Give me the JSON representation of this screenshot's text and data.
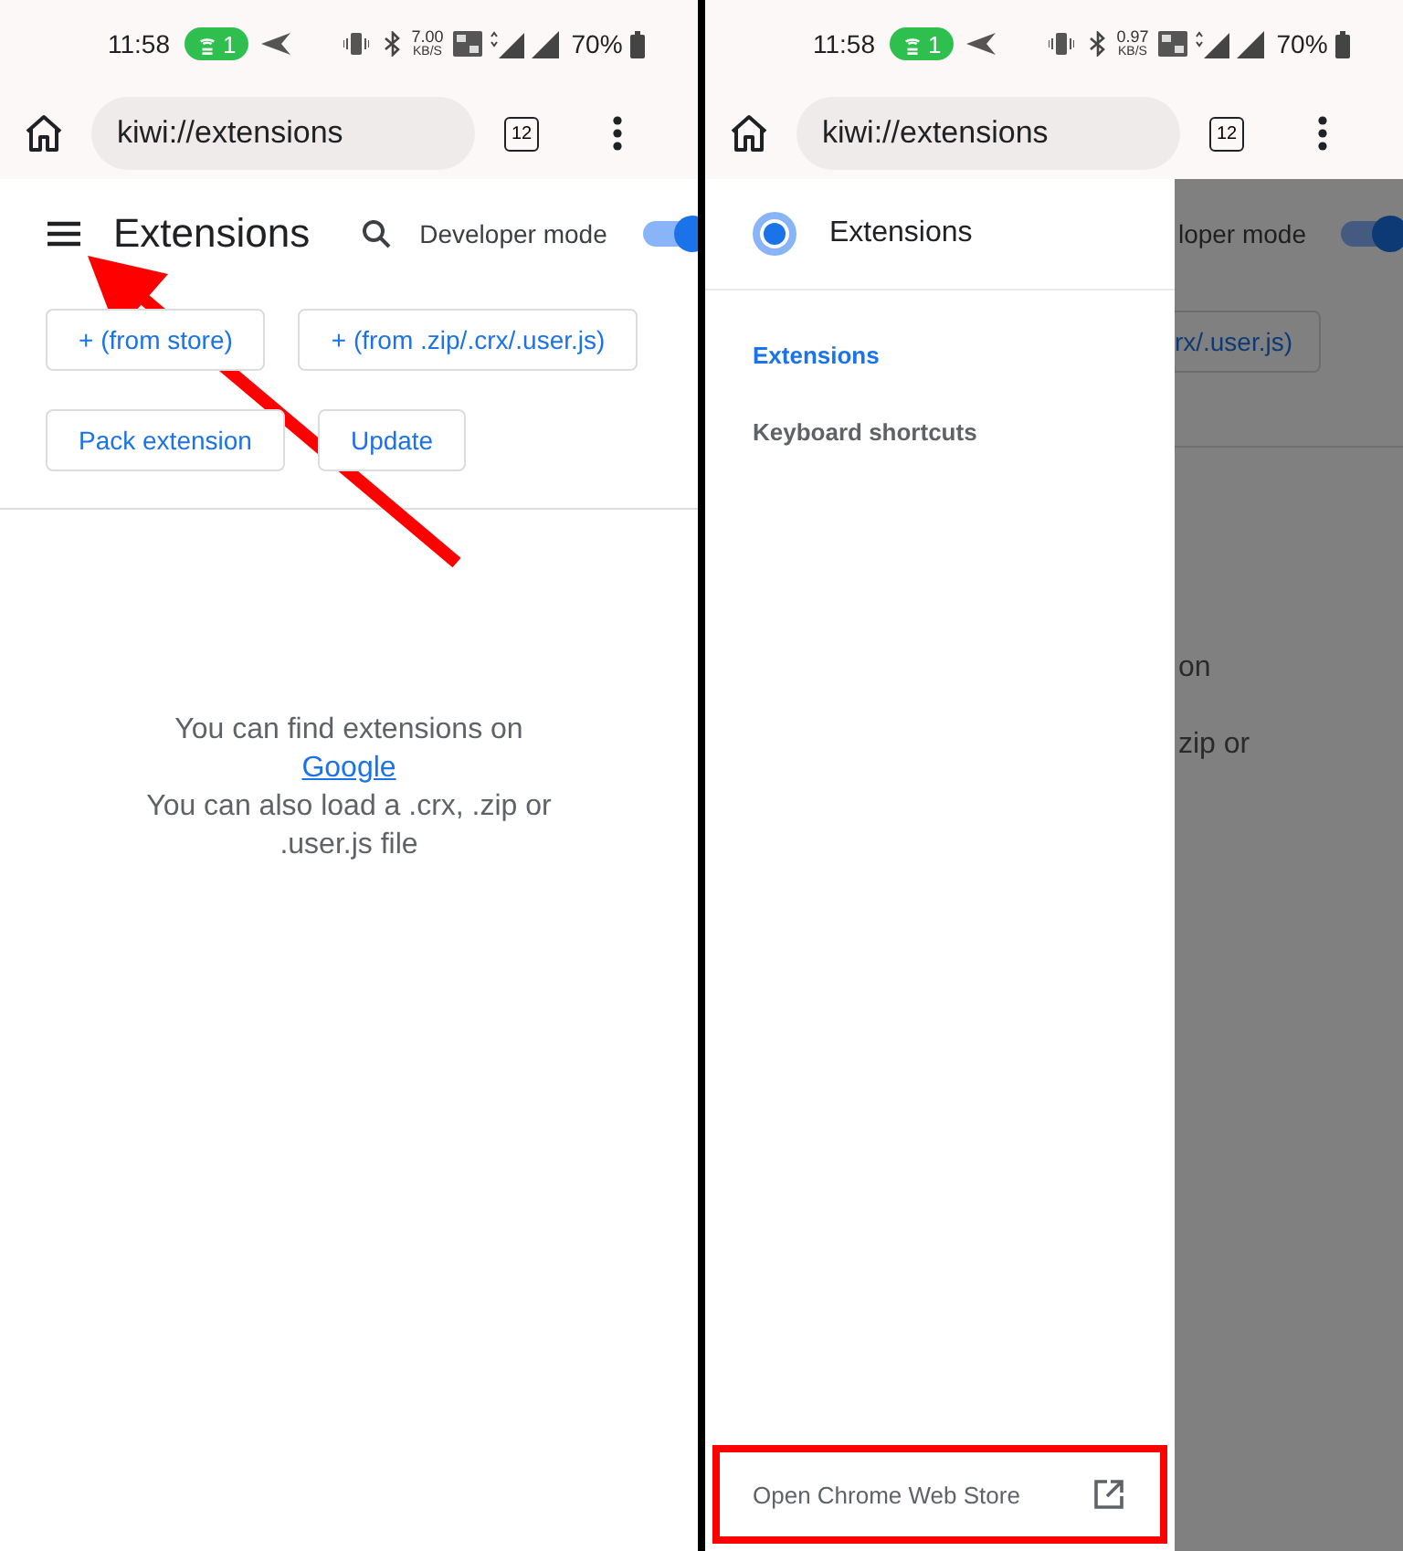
{
  "screens": [
    {
      "status_bar": {
        "time": "11:58",
        "hotspot_count": "1",
        "speed": "7.00",
        "speed_unit": "KB/S",
        "battery": "70%"
      },
      "browser_bar": {
        "url": "kiwi://extensions",
        "tab_count": "12"
      },
      "page": {
        "title": "Extensions",
        "developer_mode": {
          "label": "Developer mode",
          "on": true
        },
        "button_rows": [
          [
            {
              "label": "+ (from store)"
            },
            {
              "label": "+ (from .zip/.crx/.user.js)"
            }
          ],
          [
            {
              "label": "Pack extension"
            },
            {
              "label": "Update"
            }
          ]
        ],
        "empty_state": {
          "line_1": "You can find extensions on",
          "link": "Google",
          "line_2": "You can also load a .crx, .zip or .user.js file"
        }
      },
      "annotations": [
        {
          "kind": "arrow"
        }
      ]
    },
    {
      "status_bar": {
        "time": "11:58",
        "hotspot_count": "1",
        "speed": "0.97",
        "speed_unit": "KB/S",
        "battery": "70%"
      },
      "browser_bar": {
        "url": "kiwi://extensions",
        "tab_count": "12"
      },
      "drawer": {
        "title": "Extensions",
        "items": [
          {
            "label": "Extensions",
            "selected": true
          },
          {
            "label": "Keyboard shortcuts",
            "selected": false
          }
        ],
        "footer": {
          "label": "Open Chrome Web Store",
          "highlighted": true
        }
      },
      "dimmed_page": {
        "developer_mode": {
          "label": "loper mode",
          "on": true
        },
        "button_fragment": "rx/.user.js)",
        "text_fragments": [
          "on",
          "zip or"
        ]
      }
    }
  ]
}
